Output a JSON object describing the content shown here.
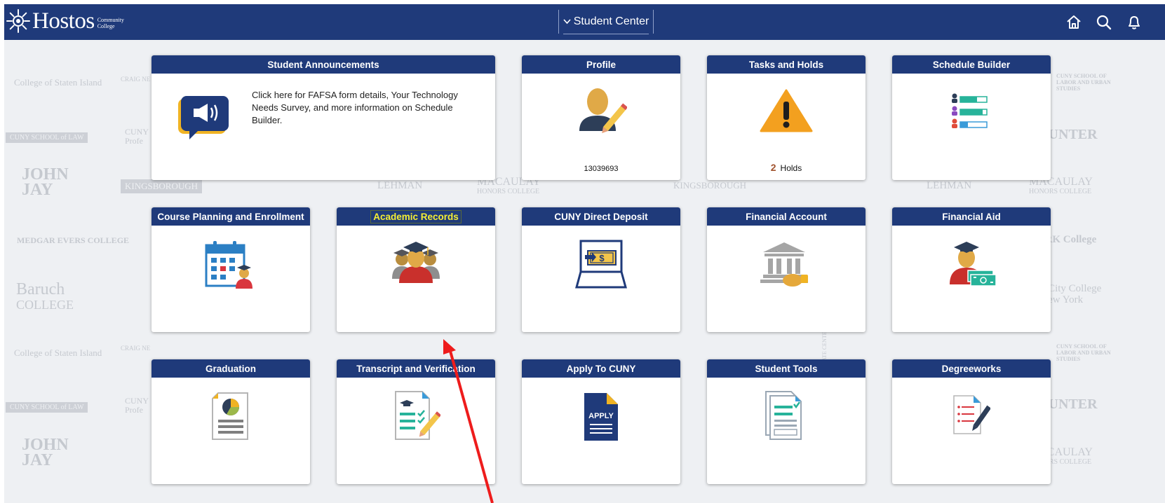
{
  "header": {
    "logo_name": "Hostos",
    "logo_sub_1": "Community",
    "logo_sub_2": "College",
    "center_title": "Student Center",
    "icons": [
      "home-icon",
      "search-icon",
      "bell-icon"
    ]
  },
  "watermarks": {
    "staten_island": "College of Staten Island",
    "cuny_law": "CUNY SCHOOL of LAW",
    "john_jay": "JOHN JAY",
    "medgar": "MEDGAR EVERS COLLEGE",
    "baruch_1": "Baruch",
    "baruch_2": "COLLEGE",
    "kingsborough": "KINGSBOROUGH",
    "lehman": "LEHMAN",
    "macaulay_1": "MACAULAY",
    "macaulay_2": "HONORS COLLEGE",
    "hunter": "HUNTER",
    "york": "YORK College",
    "ccny_1": "The City College",
    "ccny_2": "of New York",
    "cuny_labor": "CUNY SCHOOL OF LABOR AND URBAN STUDIES",
    "craig": "CRAIG NE",
    "cuny_prof": "CUNY",
    "cuny_prof_2": "Profe",
    "graduate": "GRADUATE CENTER"
  },
  "tiles": {
    "announcements": {
      "title": "Student Announcements",
      "text": "Click here for FAFSA form details, Your Technology Needs Survey, and more information on Schedule Builder."
    },
    "profile": {
      "title": "Profile",
      "id": "13039693"
    },
    "tasks": {
      "title": "Tasks and Holds",
      "count": "2",
      "label": "Holds"
    },
    "schedule": {
      "title": "Schedule Builder"
    },
    "course_planning": {
      "title": "Course Planning and Enrollment"
    },
    "academic_records": {
      "title": "Academic Records"
    },
    "direct_deposit": {
      "title": "CUNY Direct Deposit"
    },
    "financial_account": {
      "title": "Financial Account"
    },
    "financial_aid": {
      "title": "Financial Aid"
    },
    "graduation": {
      "title": "Graduation"
    },
    "transcript": {
      "title": "Transcript and Verification"
    },
    "apply": {
      "title": "Apply To CUNY",
      "icon_text": "APPLY"
    },
    "student_tools": {
      "title": "Student Tools"
    },
    "degreeworks": {
      "title": "Degreeworks"
    }
  },
  "colors": {
    "header_bg": "#1f3a7a",
    "tile_title_bg": "#1f3a7a",
    "highlight_text": "#f6ef33",
    "annotation_arrow": "#ee1c1c"
  }
}
